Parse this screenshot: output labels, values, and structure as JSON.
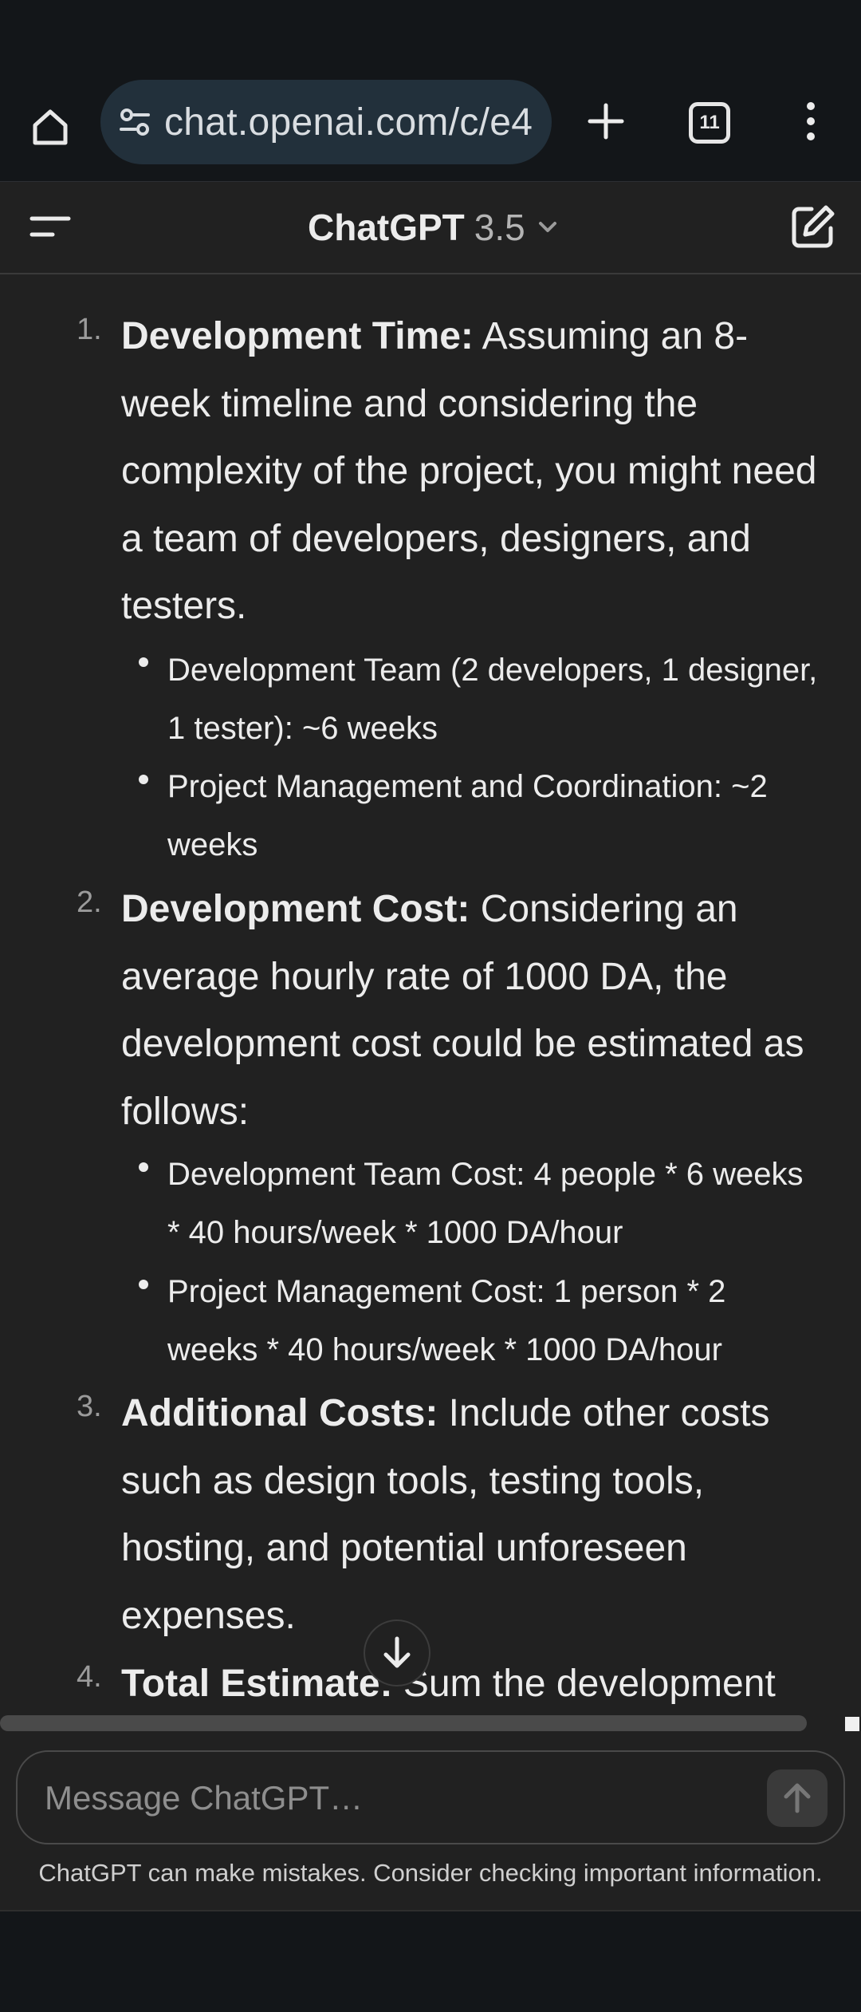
{
  "browser": {
    "url": "chat.openai.com/c/e4",
    "tab_count": "11",
    "icons": [
      "home-icon",
      "site-settings-icon",
      "plus-icon",
      "tab-switcher-icon",
      "more-vert-icon"
    ]
  },
  "header": {
    "model_name": "ChatGPT",
    "model_version": "3.5",
    "icons": [
      "menu-icon",
      "chevron-down-icon",
      "new-chat-icon"
    ]
  },
  "content": {
    "items": [
      {
        "number": "1.",
        "bold": "Development Time:",
        "text": " Assuming an 8-week timeline and considering the complexity of the project, you might need a team of developers, designers, and testers.",
        "bullets": [
          "Development Team (2 developers, 1 designer, 1 tester): ~6 weeks",
          "Project Management and Coordination: ~2 weeks"
        ]
      },
      {
        "number": "2.",
        "bold": "Development Cost:",
        "text": " Considering an average hourly rate of 1000 DA, the development cost could be estimated as follows:",
        "bullets": [
          "Development Team Cost: 4 people * 6 weeks * 40 hours/week * 1000 DA/hour",
          "Project Management Cost: 1 person * 2 weeks * 40 hours/week * 1000 DA/hour"
        ]
      },
      {
        "number": "3.",
        "bold": "Additional Costs:",
        "text": " Include other costs such as design tools, testing tools, hosting, and potential unforeseen expenses.",
        "bullets": []
      },
      {
        "number": "4.",
        "bold": "Total Estimate:",
        "text": " Sum the development",
        "bullets": []
      }
    ]
  },
  "composer": {
    "placeholder": "Message ChatGPT…",
    "value": ""
  },
  "footer": {
    "disclaimer": "ChatGPT can make mistakes. Consider checking important information."
  },
  "colors": {
    "background": "#212121",
    "browser_bar": "#131619",
    "url_pill": "#22303b",
    "text": "#ececec",
    "muted_text": "#b4b4b4"
  }
}
